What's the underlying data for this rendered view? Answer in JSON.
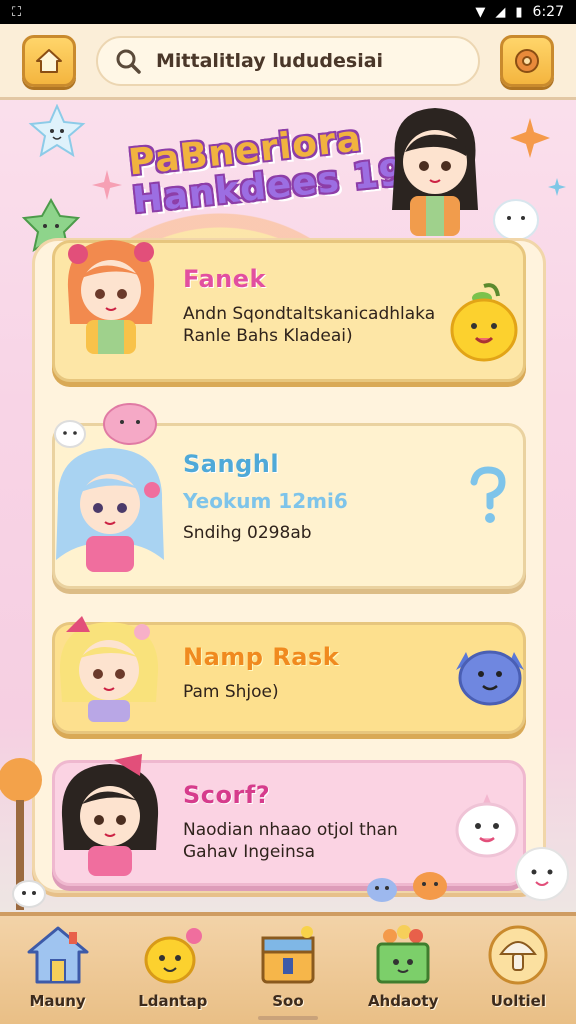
{
  "status_bar": {
    "time": "6:27"
  },
  "header": {
    "search_text": "Mittalitlay lududesiai",
    "home_icon": "home-icon",
    "settings_icon": "donut-icon"
  },
  "title": {
    "line1": "PaBneriora",
    "line2": "Hankdees 19"
  },
  "cards": [
    {
      "title": "Fanek",
      "lines": [
        "Andn Sqondtaltskanicadhlaka",
        "Ranle Bahs Kladeai)"
      ],
      "mascot": "lemon-mascot-icon"
    },
    {
      "title": "Sanghl",
      "subtitle": "Yeokum 12mi6",
      "lines": [
        "Sndihg 0298ab"
      ],
      "mascot": "question-mark-icon"
    },
    {
      "title": "Namp Rask",
      "lines": [
        "Pam Shjoe)"
      ],
      "mascot": "blue-blob-mascot-icon"
    },
    {
      "title": "Scorf?",
      "lines": [
        "Naodian nhaao otjol than",
        "Gahav Ingeinsa"
      ],
      "mascot": "ghost-mascot-icon"
    }
  ],
  "nav": [
    {
      "label": "Mauny",
      "icon": "house-icon"
    },
    {
      "label": "Ldantap",
      "icon": "star-friend-icon"
    },
    {
      "label": "Soo",
      "icon": "box-icon"
    },
    {
      "label": "Ahdaoty",
      "icon": "treasure-icon"
    },
    {
      "label": "Uoltiel",
      "icon": "mushroom-icon"
    }
  ],
  "colors": {
    "accent": "#f4b53f",
    "panel": "#fff3dd",
    "nav_bg": "#e9bf86"
  }
}
